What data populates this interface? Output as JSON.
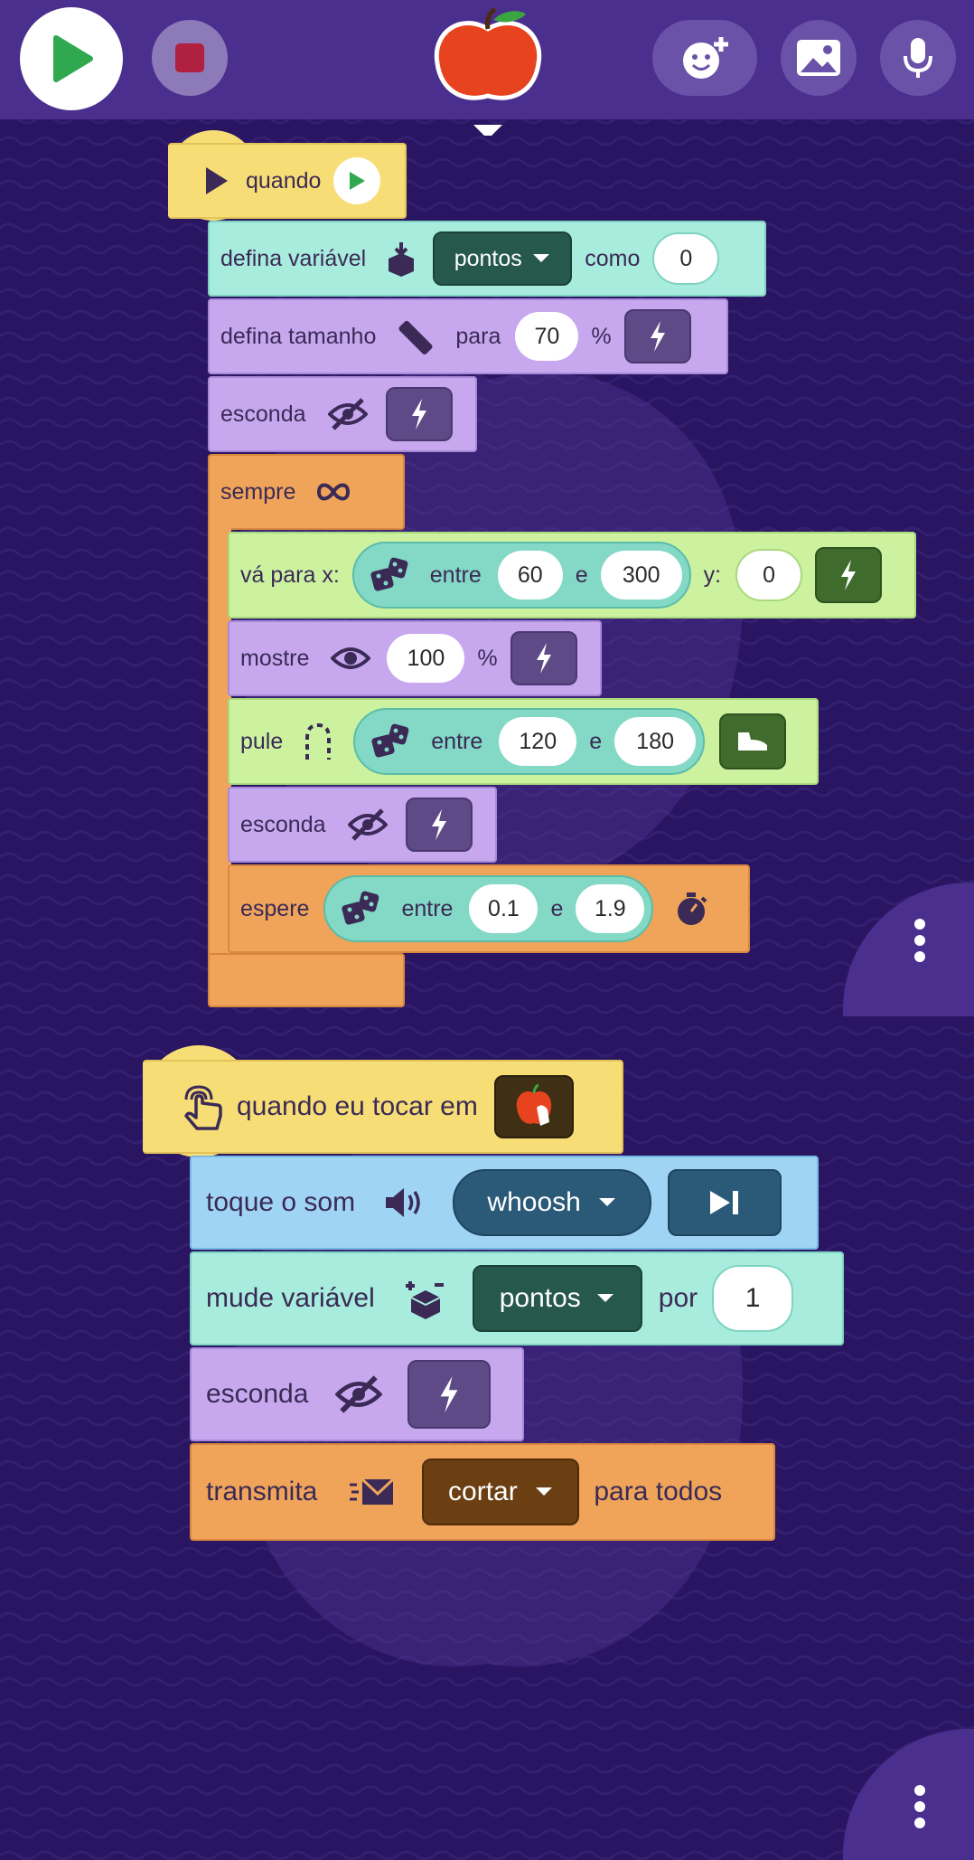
{
  "colors": {
    "background": "#2a1563",
    "topbar": "#4a2f8e",
    "play_green": "#2fa84f",
    "stop_red": "#b02040"
  },
  "toolbar": {
    "icons": [
      "play-icon",
      "stop-icon",
      "add-sprite-icon",
      "image-icon",
      "microphone-icon"
    ]
  },
  "script1": {
    "when": "quando",
    "set_var": {
      "label": "defina variável",
      "var": "pontos",
      "as": "como",
      "value": "0"
    },
    "set_size": {
      "label": "defina tamanho",
      "to": "para",
      "value": "70",
      "unit": "%"
    },
    "hide1": {
      "label": "esconda"
    },
    "forever": {
      "label": "sempre"
    },
    "goto": {
      "label": "vá para x:",
      "between": "entre",
      "min": "60",
      "and": "e",
      "max": "300",
      "y_label": "y:",
      "y": "0"
    },
    "show": {
      "label": "mostre",
      "value": "100",
      "unit": "%"
    },
    "jump": {
      "label": "pule",
      "between": "entre",
      "min": "120",
      "and": "e",
      "max": "180"
    },
    "hide2": {
      "label": "esconda"
    },
    "wait": {
      "label": "espere",
      "between": "entre",
      "min": "0.1",
      "and": "e",
      "max": "1.9"
    }
  },
  "script2": {
    "when_touch": "quando eu tocar em",
    "play_sound": {
      "label": "toque o som",
      "sound": "whoosh"
    },
    "change_var": {
      "label": "mude variável",
      "var": "pontos",
      "by": "por",
      "value": "1"
    },
    "hide": {
      "label": "esconda"
    },
    "broadcast": {
      "label": "transmita",
      "message": "cortar",
      "to": "para todos"
    }
  }
}
